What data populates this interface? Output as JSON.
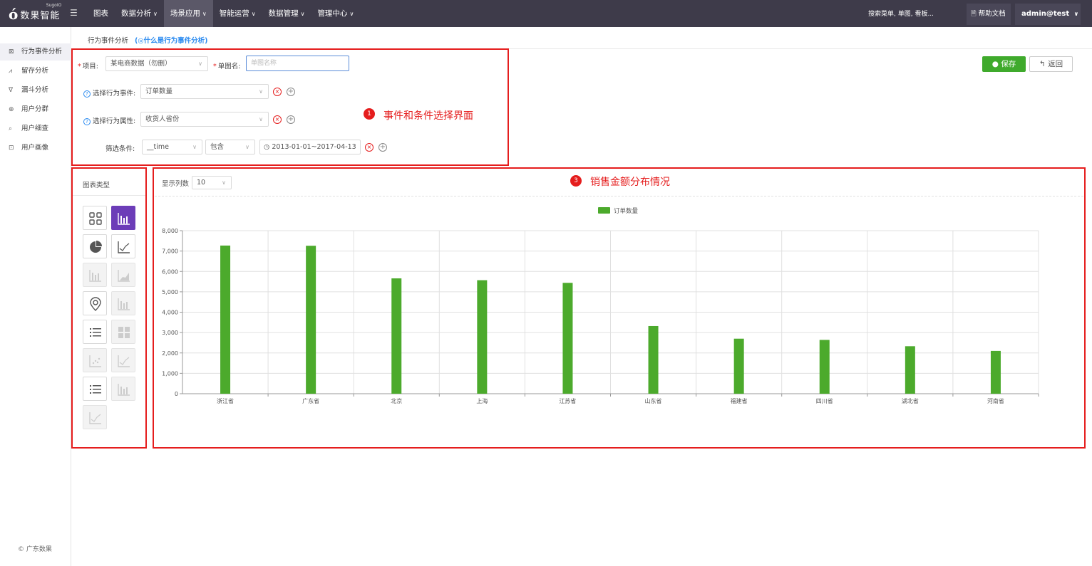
{
  "app": {
    "logo_mark": "ó",
    "logo_text": "数果智能",
    "logo_sup": "SugoIO"
  },
  "nav": [
    {
      "label": "图表",
      "active": false
    },
    {
      "label": "数据分析",
      "active": false
    },
    {
      "label": "场景应用",
      "active": true
    },
    {
      "label": "智能运营",
      "active": false
    },
    {
      "label": "数据管理",
      "active": false
    },
    {
      "label": "管理中心",
      "active": false
    }
  ],
  "topbar": {
    "search_placeholder": "搜索菜单, 单图, 看板...",
    "help_label": "帮助文档",
    "user_label": "admin@test"
  },
  "sidebar": {
    "items": [
      {
        "label": "行为事件分析",
        "icon": "event-icon",
        "active": true
      },
      {
        "label": "留存分析",
        "icon": "retention-icon",
        "active": false
      },
      {
        "label": "漏斗分析",
        "icon": "funnel-icon",
        "active": false
      },
      {
        "label": "用户分群",
        "icon": "group-icon",
        "active": false
      },
      {
        "label": "用户细查",
        "icon": "search-icon",
        "active": false
      },
      {
        "label": "用户画像",
        "icon": "portrait-icon",
        "active": false
      }
    ],
    "copyright": "© 广东数果"
  },
  "breadcrumb": {
    "title": "行为事件分析",
    "help_link": "(◎什么是行为事件分析)"
  },
  "form": {
    "project_label": "项目:",
    "project_value": "某电商数据（勿删）",
    "chart_name_label": "单图名:",
    "chart_name_placeholder": "单图名称",
    "event_label": "选择行为事件:",
    "event_value": "订单数量",
    "property_label": "选择行为属性:",
    "property_value": "收货人省份",
    "filter_label": "筛选条件:",
    "filter_field": "__time",
    "filter_op": "包含",
    "filter_value": "2013-01-01~2017-04-13"
  },
  "buttons": {
    "save": "保存",
    "back": "返回"
  },
  "annotations": {
    "a1_num": "1",
    "a1_text": "事件和条件选择界面",
    "a3_num": "3",
    "a3_text": "销售金额分布情况"
  },
  "chart_panel": {
    "title": "图表类型",
    "types": [
      {
        "icon": "table-grid-icon",
        "state": "normal"
      },
      {
        "icon": "bar-chart-icon",
        "state": "selected"
      },
      {
        "icon": "pie-chart-icon",
        "state": "normal"
      },
      {
        "icon": "line-chart-icon",
        "state": "normal"
      },
      {
        "icon": "bar-chart-icon",
        "state": "disabled"
      },
      {
        "icon": "area-chart-icon",
        "state": "disabled"
      },
      {
        "icon": "map-pin-icon",
        "state": "normal"
      },
      {
        "icon": "bar-chart-icon",
        "state": "disabled"
      },
      {
        "icon": "list-icon",
        "state": "normal"
      },
      {
        "icon": "heatmap-icon",
        "state": "disabled"
      },
      {
        "icon": "scatter-icon",
        "state": "disabled"
      },
      {
        "icon": "line-chart-icon",
        "state": "disabled"
      },
      {
        "icon": "list-icon",
        "state": "normal"
      },
      {
        "icon": "bar-chart-icon",
        "state": "disabled"
      },
      {
        "icon": "line-chart-icon",
        "state": "disabled"
      }
    ]
  },
  "display": {
    "rows_label": "显示列数",
    "rows_value": "10"
  },
  "colors": {
    "bar": "#4caa2c",
    "accent": "#6c3db8",
    "annotation": "#e51d1d",
    "topbar": "#3e3b4a"
  },
  "chart_data": {
    "type": "bar",
    "categories": [
      "浙江省",
      "广东省",
      "北京",
      "上海",
      "江苏省",
      "山东省",
      "福建省",
      "四川省",
      "湖北省",
      "河南省"
    ],
    "series": [
      {
        "name": "订单数量",
        "values": [
          7270,
          7260,
          5660,
          5570,
          5440,
          3320,
          2700,
          2640,
          2330,
          2100
        ]
      }
    ],
    "ylim": [
      0,
      8000
    ],
    "yticks": [
      "8,000",
      "7,000",
      "6,000",
      "5,000",
      "4,000",
      "3,000",
      "2,000",
      "1,000",
      "0"
    ],
    "grid": true,
    "legend": "top-center"
  }
}
